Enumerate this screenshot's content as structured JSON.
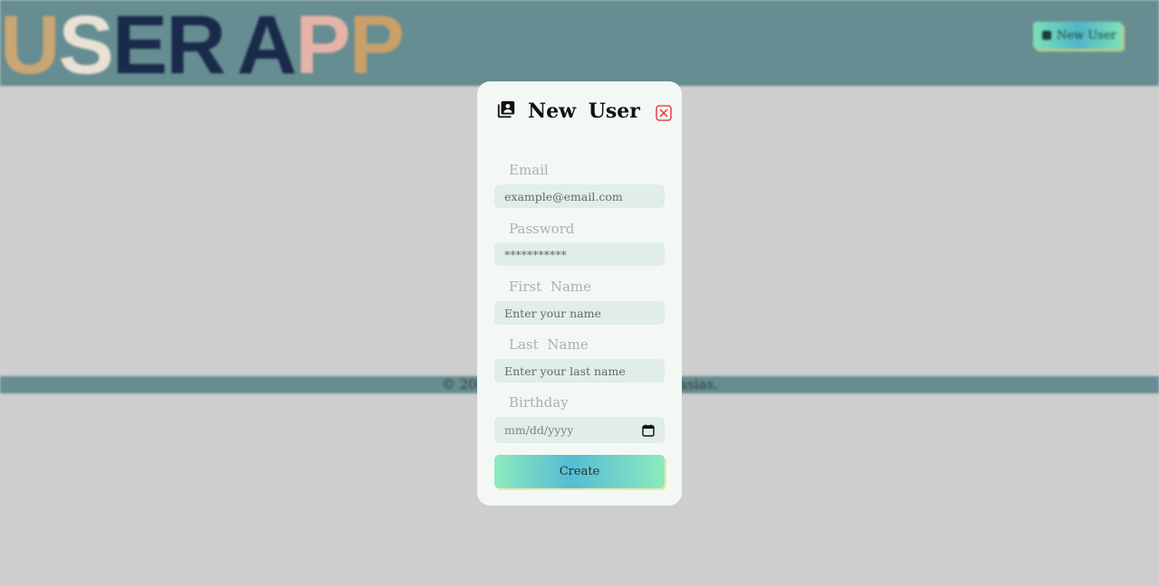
{
  "background": {
    "logo_letters": [
      "U",
      "S",
      "E",
      "R",
      " ",
      "A",
      "P",
      "P"
    ],
    "new_user_button": "New User",
    "footer_left": "© 20",
    "footer_right": "asias."
  },
  "modal": {
    "title": "New User",
    "fields": {
      "email": {
        "label": "Email",
        "placeholder": "example@email.com"
      },
      "password": {
        "label": "Password",
        "placeholder": "***********"
      },
      "first_name": {
        "label": "First Name",
        "placeholder": "Enter your name"
      },
      "last_name": {
        "label": "Last Name",
        "placeholder": "Enter your last name"
      },
      "birthday": {
        "label": "Birthday",
        "placeholder": "mm/dd/yyyy"
      }
    },
    "create_label": "Create"
  },
  "colors": {
    "header_bg": "#668d91",
    "modal_bg": "#f3f8f5",
    "input_bg": "#e1ede7",
    "close_red": "#e5474b",
    "accent_green": "#8deabe",
    "accent_blue": "#55bcd4"
  },
  "icons": {
    "title_icon": "contacts-book-icon",
    "close_icon": "close-square-icon",
    "calendar_icon": "calendar-icon"
  }
}
